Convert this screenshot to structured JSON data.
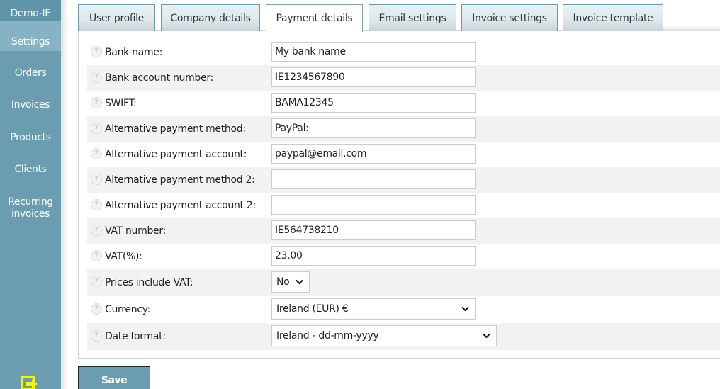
{
  "sidebar": {
    "brand": "Demo-IE",
    "items": [
      {
        "label": "Settings",
        "active": true
      },
      {
        "label": "Orders"
      },
      {
        "label": "Invoices"
      },
      {
        "label": "Products"
      },
      {
        "label": "Clients"
      },
      {
        "label": "Recurring invoices"
      }
    ],
    "logout_icon": "logout-icon"
  },
  "tabs": [
    {
      "label": "User profile"
    },
    {
      "label": "Company details"
    },
    {
      "label": "Payment details",
      "active": true
    },
    {
      "label": "Email settings"
    },
    {
      "label": "Invoice settings"
    },
    {
      "label": "Invoice template"
    }
  ],
  "form": {
    "bank_name": {
      "label": "Bank name:",
      "value": "My bank name"
    },
    "bank_account": {
      "label": "Bank account number:",
      "value": "IE1234567890"
    },
    "swift": {
      "label": "SWIFT:",
      "value": "BAMA12345"
    },
    "alt_method": {
      "label": "Alternative payment method:",
      "value": "PayPal:"
    },
    "alt_account": {
      "label": "Alternative payment account:",
      "value": "paypal@email.com"
    },
    "alt_method2": {
      "label": "Alternative payment method 2:",
      "value": ""
    },
    "alt_account2": {
      "label": "Alternative payment account 2:",
      "value": ""
    },
    "vat_number": {
      "label": "VAT number:",
      "value": "IE564738210"
    },
    "vat_percent": {
      "label": "VAT(%):",
      "value": "23.00"
    },
    "prices_include_vat": {
      "label": "Prices include VAT:",
      "selected": "No"
    },
    "currency": {
      "label": "Currency:",
      "selected": "Ireland (EUR) €"
    },
    "date_format": {
      "label": "Date format:",
      "selected": "Ireland - dd-mm-yyyy"
    }
  },
  "help_icon_glyph": "?",
  "actions": {
    "save_label": "Save"
  },
  "colors": {
    "sidebar": "#6a9daf",
    "sidebar_active": "#86b3c3",
    "logout_icon": "#f5f500"
  }
}
